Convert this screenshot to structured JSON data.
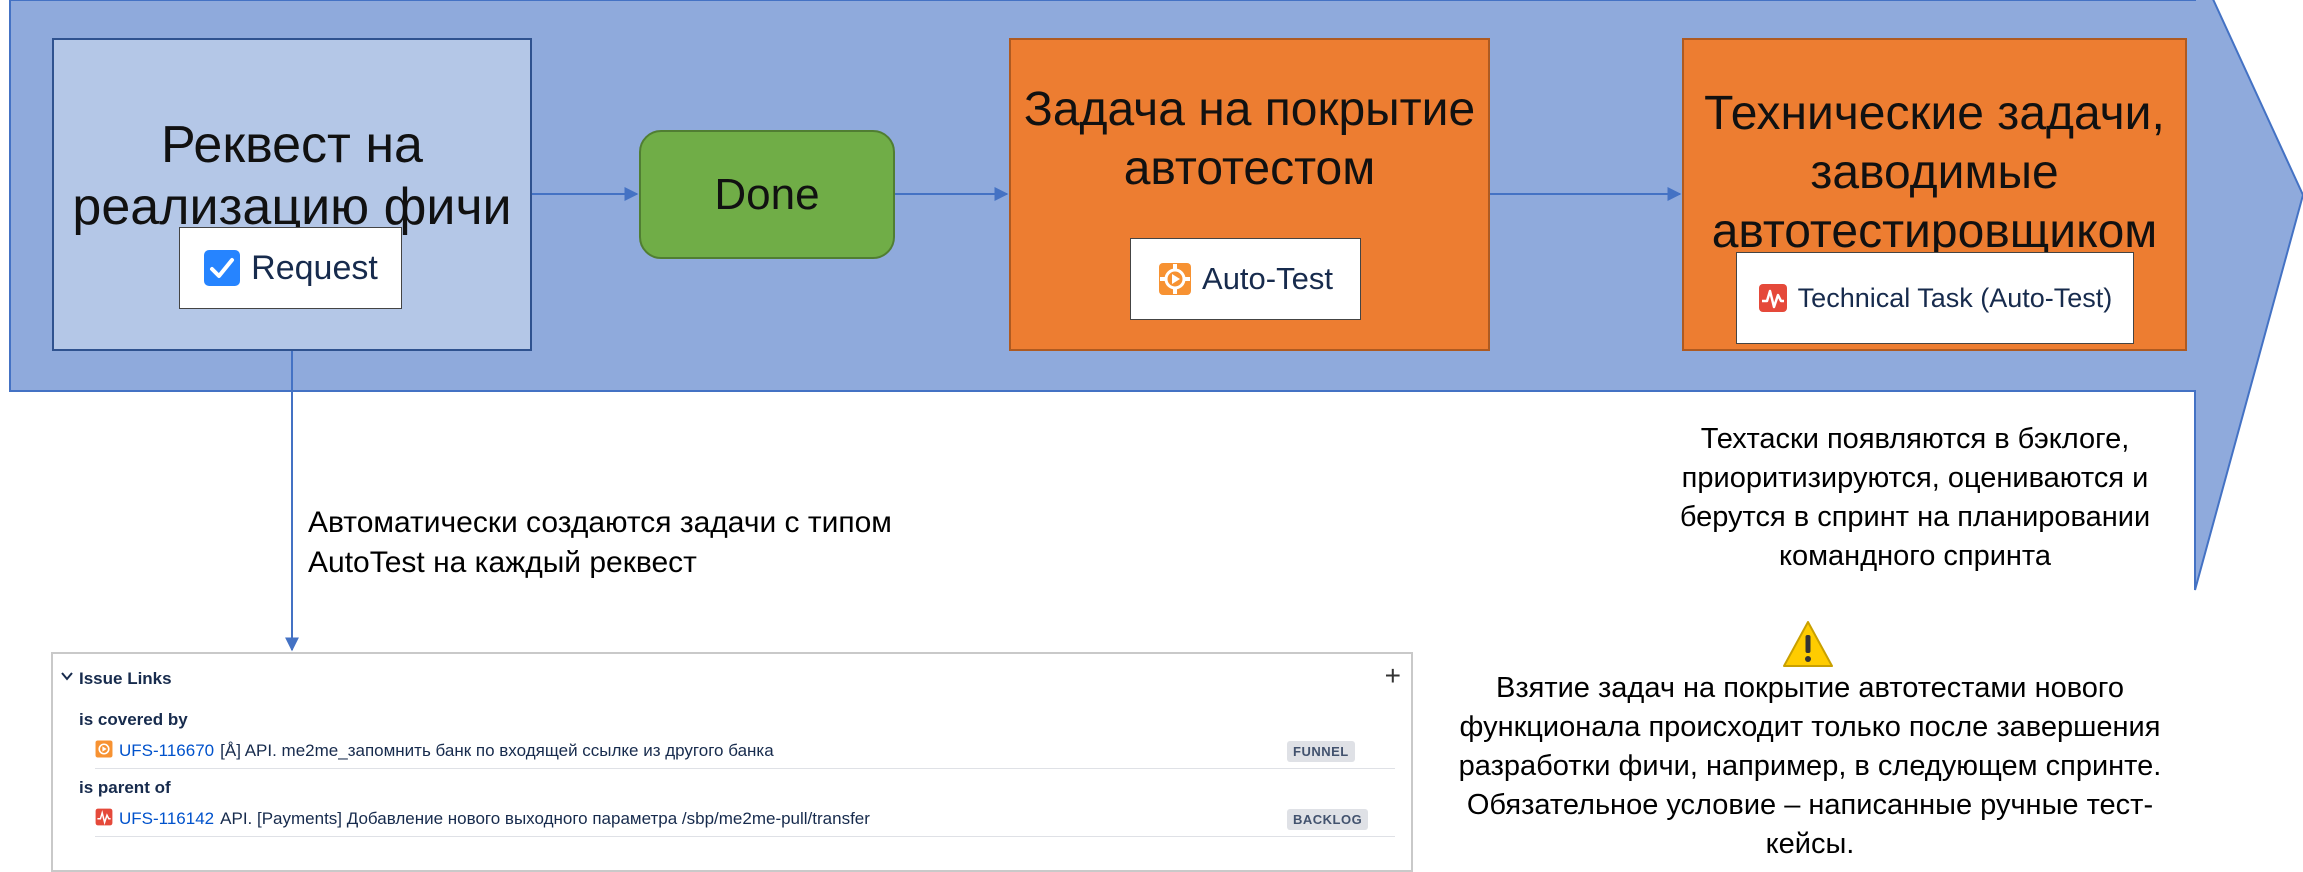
{
  "request_box": {
    "title": "Реквест на реализацию фичи",
    "chip_label": "Request"
  },
  "done_box": {
    "title": "Done"
  },
  "autotest_box": {
    "title": "Задача на покрытие автотестом",
    "chip_label": "Auto-Test"
  },
  "techtask_box": {
    "title": "Технические задачи, заводимые автотестировщиком",
    "chip_label": "Technical Task (Auto-Test)"
  },
  "auto_note": "Автоматически создаются задачи с типом AutoTest на каждый реквест",
  "backlog_note": "Техтаски появляются в бэклоге, приоритизируются, оцениваются и берутся в спринт на планировании командного спринта",
  "warning_note": "Взятие задач на покрытие автотестами нового функционала происходит только после завершения разработки фичи, например, в следующем спринте. Обязательное условие – написанные ручные тест-кейсы.",
  "issue_links": {
    "header": "Issue Links",
    "add_symbol": "+",
    "groups": [
      {
        "relation": "is covered by",
        "key": "UFS-116670",
        "summary": "[Å] API. me2me_запомнить банк по входящей ссылке из другого банка",
        "status": "FUNNEL"
      },
      {
        "relation": "is parent of",
        "key": "UFS-116142",
        "summary": "API. [Payments] Добавление нового выходного параметра /sbp/me2me-pull/transfer",
        "status": "BACKLOG"
      }
    ]
  },
  "colors": {
    "band_fill": "#8faadc",
    "request_fill": "#b4c7e7",
    "done_fill": "#70ad47",
    "task_fill": "#ed7d31",
    "connector": "#4472c4",
    "link_blue": "#0052cc"
  }
}
